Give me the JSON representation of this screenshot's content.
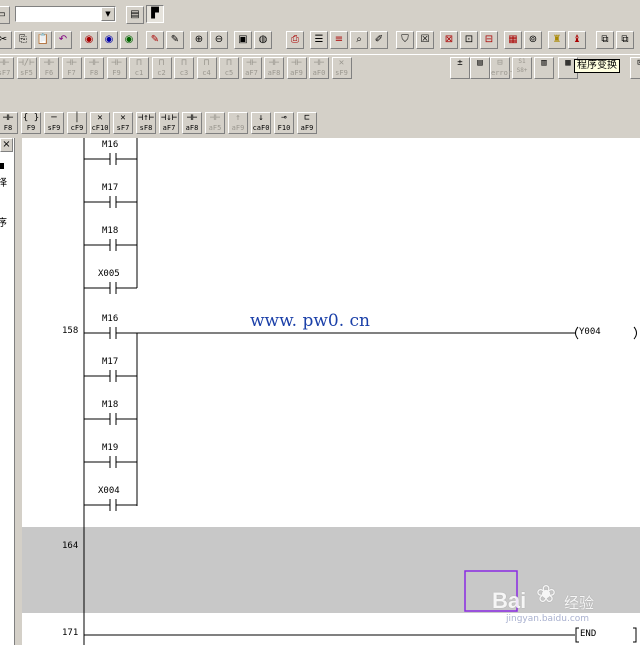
{
  "toolbar": {
    "select_value": "",
    "tooltip": "程序变换",
    "fkeys_row1": [
      "sF7",
      "sF5",
      "F6",
      "F7",
      "F8",
      "F9",
      "c1",
      "c2",
      "c3",
      "c4",
      "c5",
      "aF7",
      "aF8",
      "aF9",
      "aF0",
      "sF9"
    ],
    "fkeys_row1b": [
      "error",
      "S1 S8+"
    ],
    "fkeys_row2": [
      "F8",
      "F9",
      "sF9",
      "cF9",
      "cF10",
      "sF7",
      "sF8",
      "aF7",
      "aF8",
      "aF5",
      "aF9",
      "caF0",
      "F10",
      "aF9"
    ]
  },
  "side_panel": {
    "close": "×",
    "text1": "择",
    "text2": "序"
  },
  "ladder": {
    "step_158": "158",
    "step_164": "164",
    "step_171": "171",
    "top_contacts": [
      "M16",
      "M17",
      "M18",
      "X005"
    ],
    "rung2_contacts": [
      "M16",
      "M17",
      "M18",
      "M19",
      "X004"
    ],
    "coil_y004": "Y004",
    "end_label": "END"
  },
  "watermark": {
    "url": "www. pw0. cn",
    "brand": "Bai",
    "brand_cn": "经验",
    "brand_url": "jingyan.baidu.com"
  },
  "colors": {
    "gray_band": "#c8c8c8",
    "selection": "#8a2be2",
    "watermark": "#1a3fa8"
  }
}
